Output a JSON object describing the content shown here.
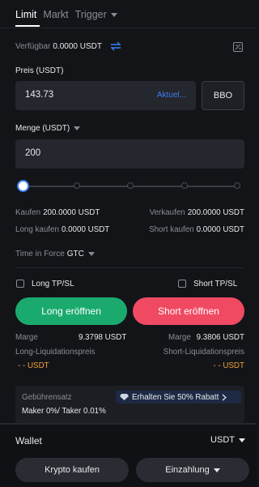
{
  "tabs": [
    {
      "label": "Limit"
    },
    {
      "label": "Markt"
    },
    {
      "label": "Trigger"
    }
  ],
  "available": {
    "label": "Verfügbar",
    "value": "0.0000 USDT"
  },
  "price": {
    "label": "Preis (USDT)",
    "value": "143.73",
    "link": "Aktuel...",
    "bbo": "BBO"
  },
  "quantity": {
    "label": "Menge (USDT)",
    "value": "200"
  },
  "slider": {
    "percent": 0
  },
  "stats": {
    "buy_label": "Kaufen",
    "buy_value": "200.0000 USDT",
    "sell_label": "Verkaufen",
    "sell_value": "200.0000 USDT",
    "long_buy_label": "Long kaufen",
    "long_buy_value": "0.0000 USDT",
    "short_buy_label": "Short kaufen",
    "short_buy_value": "0.0000 USDT"
  },
  "time_in_force": {
    "label": "Time in Force",
    "value": "GTC"
  },
  "tpsl": {
    "long_label": "Long TP/SL",
    "short_label": "Short TP/SL"
  },
  "actions": {
    "long": "Long eröffnen",
    "short": "Short eröffnen"
  },
  "margin": {
    "long_label": "Marge",
    "long_value": "9.3798 USDT",
    "short_label": "Marge",
    "short_value": "9.3806 USDT",
    "long_liq_label": "Long-Liquidationspreis",
    "long_liq_value": "- - USDT",
    "short_liq_label": "Short-Liquidationspreis",
    "short_liq_value": "- - USDT"
  },
  "fees": {
    "label": "Gebührensatz",
    "rates": "Maker 0%/ Taker 0.01%",
    "rebate": "Erhalten Sie 50% Rabatt"
  },
  "wallet": {
    "label": "Wallet",
    "currency": "USDT",
    "buy_button": "Krypto kaufen",
    "deposit_button": "Einzahlung"
  },
  "colors": {
    "accent": "#3b7ef5",
    "long": "#1aaa6e",
    "short": "#f04a63",
    "warning": "#f0a034"
  }
}
